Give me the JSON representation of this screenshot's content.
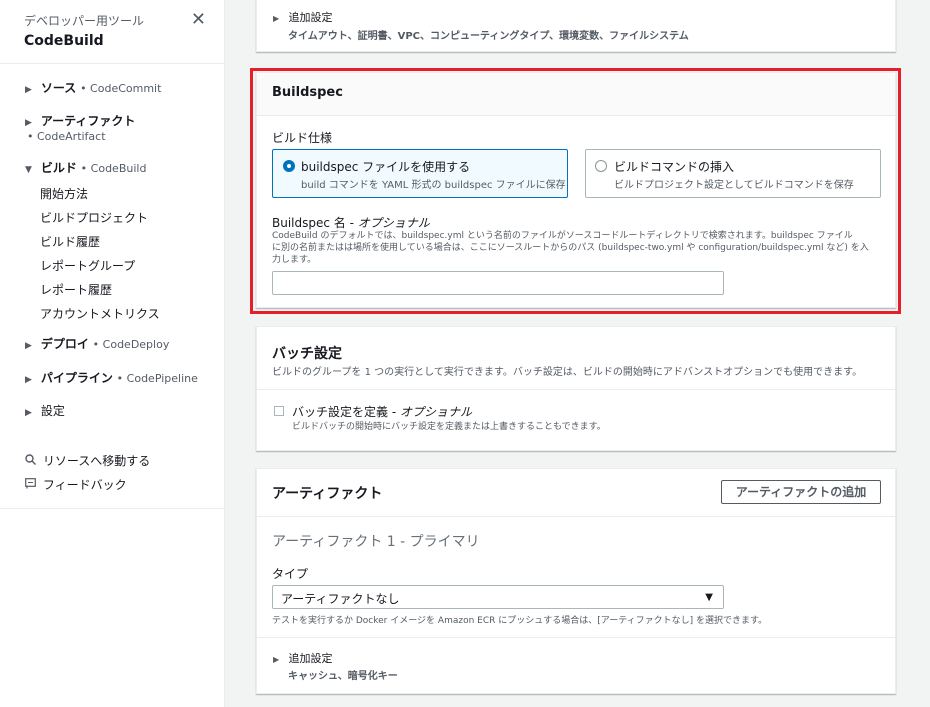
{
  "sidebar": {
    "subtitle": "デベロッパー用ツール",
    "title": "CodeBuild",
    "sections": [
      {
        "name": "ソース",
        "service": "• CodeCommit"
      },
      {
        "name": "アーティファクト",
        "service": "• CodeArtifact"
      },
      {
        "name": "ビルド",
        "service": "• CodeBuild"
      },
      {
        "name": "デプロイ",
        "service": "• CodeDeploy"
      },
      {
        "name": "パイプライン",
        "service": "• CodePipeline"
      },
      {
        "name": "設定",
        "service": ""
      }
    ],
    "build_links": [
      "開始方法",
      "ビルドプロジェクト",
      "ビルド履歴",
      "レポートグループ",
      "レポート履歴",
      "アカウントメトリクス"
    ],
    "goto_resource": "リソースへ移動する",
    "feedback": "フィードバック"
  },
  "top_panel": {
    "additional_label": "追加設定",
    "additional_desc": "タイムアウト、証明書、VPC、コンピューティングタイプ、環境変数、ファイルシステム"
  },
  "buildspec": {
    "header": "Buildspec",
    "spec_label": "ビルド仕様",
    "option1_title": "buildspec ファイルを使用する",
    "option1_desc": "build コマンドを YAML 形式の buildspec ファイルに保存",
    "option2_title": "ビルドコマンドの挿入",
    "option2_desc": "ビルドプロジェクト設定としてビルドコマンドを保存",
    "name_label": "Buildspec 名 - ",
    "name_optional": "オプショナル",
    "name_desc_1": "CodeBuild のデフォルトでは、buildspec.yml という名前のファイルがソースコードルートディレクトリで検索されます。buildspec ファイル",
    "name_desc_2": "に別の名前またはは場所を使用している場合は、ここにソースルートからのパス (buildspec-two.yml や configuration/buildspec.yml など) を入",
    "name_desc_3": "力します。",
    "name_value": ""
  },
  "batch": {
    "header": "バッチ設定",
    "desc": "ビルドのグループを 1 つの実行として実行できます。バッチ設定は、ビルドの開始時にアドバンストオプションでも使用できます。",
    "check_label": "バッチ設定を定義 - ",
    "check_optional": "オプショナル",
    "check_desc": "ビルドバッチの開始時にバッチ設定を定義または上書きすることもできます。"
  },
  "artifacts": {
    "header": "アーティファクト",
    "add_button": "アーティファクトの追加",
    "primary_title": "アーティファクト 1 - プライマリ",
    "type_label": "タイプ",
    "type_value": "アーティファクトなし",
    "type_desc": "テストを実行するか Docker イメージを Amazon ECR にプッシュする場合は、[アーティファクトなし] を選択できます。",
    "additional_label": "追加設定",
    "additional_desc": "キャッシュ、暗号化キー"
  },
  "colors": {
    "accent": "#0073bb",
    "highlight": "#e61e29"
  }
}
